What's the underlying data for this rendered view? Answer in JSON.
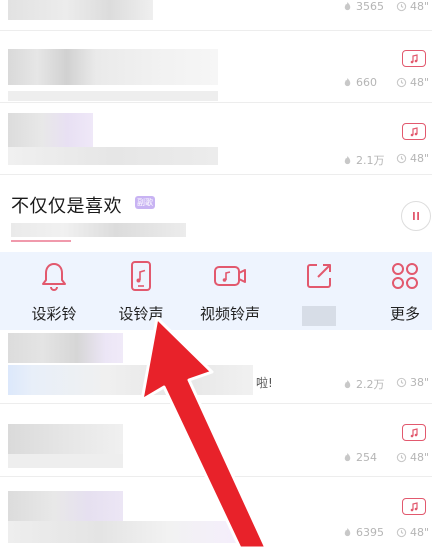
{
  "song_list": {
    "rows": [
      {
        "likes": "3565",
        "duration": "48\"",
        "has_video": false
      },
      {
        "likes": "660",
        "duration": "48\"",
        "has_video": true
      },
      {
        "likes": "2.1万",
        "duration": "48\"",
        "has_video": true
      },
      {
        "likes": "2.2万",
        "duration": "38\"",
        "has_video": false,
        "title_suffix": "啦!"
      },
      {
        "likes": "254",
        "duration": "48\"",
        "has_video": true
      },
      {
        "likes": "6395",
        "duration": "48\"",
        "has_video": true
      }
    ]
  },
  "now_playing": {
    "title": "不仅仅是喜欢",
    "badge": "副歌"
  },
  "actions": [
    {
      "label": "设彩铃",
      "icon": "bell-icon"
    },
    {
      "label": "设铃声",
      "icon": "phone-music-icon"
    },
    {
      "label": "视频铃声",
      "icon": "video-ringtone-icon"
    },
    {
      "label": "",
      "icon": "share-icon"
    },
    {
      "label": "更多",
      "icon": "more-icon"
    }
  ],
  "colors": {
    "accent": "#e2596e",
    "panel_bg": "#eef4fe",
    "arrow": "#e8222a"
  }
}
